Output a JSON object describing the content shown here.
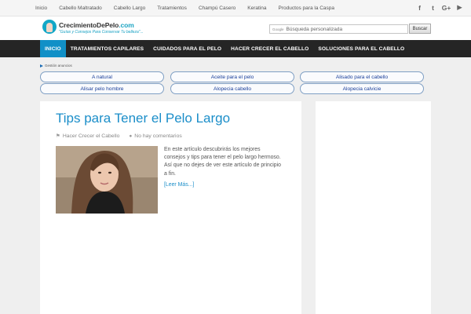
{
  "topnav": {
    "items": [
      "Inicio",
      "Cabello Maltratado",
      "Cabello Largo",
      "Tratamientos",
      "Champú Casero",
      "Keratina",
      "Productos para la Caspa"
    ]
  },
  "social": {
    "facebook": "f",
    "twitter": "t",
    "googleplus": "G+",
    "youtube": "▶"
  },
  "header": {
    "logo_name": "CrecimientoDePelo",
    "logo_tld": ".com",
    "tagline": "\"Guías y Consejos Para Conservar Tu belleza\"...",
    "search_brand": "Google",
    "search_placeholder": "Búsqueda personalizada",
    "search_button": "Buscar"
  },
  "mainnav": {
    "items": [
      "INICIO",
      "TRATAMIENTOS CAPILARES",
      "CUIDADOS PARA EL PELO",
      "HACER CRECER EL CABELLO",
      "SOLUCIONES PARA EL CABELLO"
    ],
    "active_index": 0,
    "active_color": "#1190c7"
  },
  "ads": {
    "label": "Gestión anuncios",
    "links": [
      "A natural",
      "Aceite para el pelo",
      "Alisado para el cabello",
      "Alisar pelo hombre",
      "Alopecia cabello",
      "Alopecia calvicie"
    ]
  },
  "post": {
    "title": "Tips para Tener el Pelo Largo",
    "category": "Hacer Crecer el Cabello",
    "comments": "No hay comentarios",
    "excerpt": "En este artículo descubrirás los mejores consejos y tips para tener el pelo largo hermoso. Así que no dejes de ver este artículo de principio a fin.",
    "read_more": "[Leer Más...]"
  },
  "colors": {
    "accent": "#1190c7",
    "title": "#1b8ec9",
    "nav_bg": "#252525"
  }
}
